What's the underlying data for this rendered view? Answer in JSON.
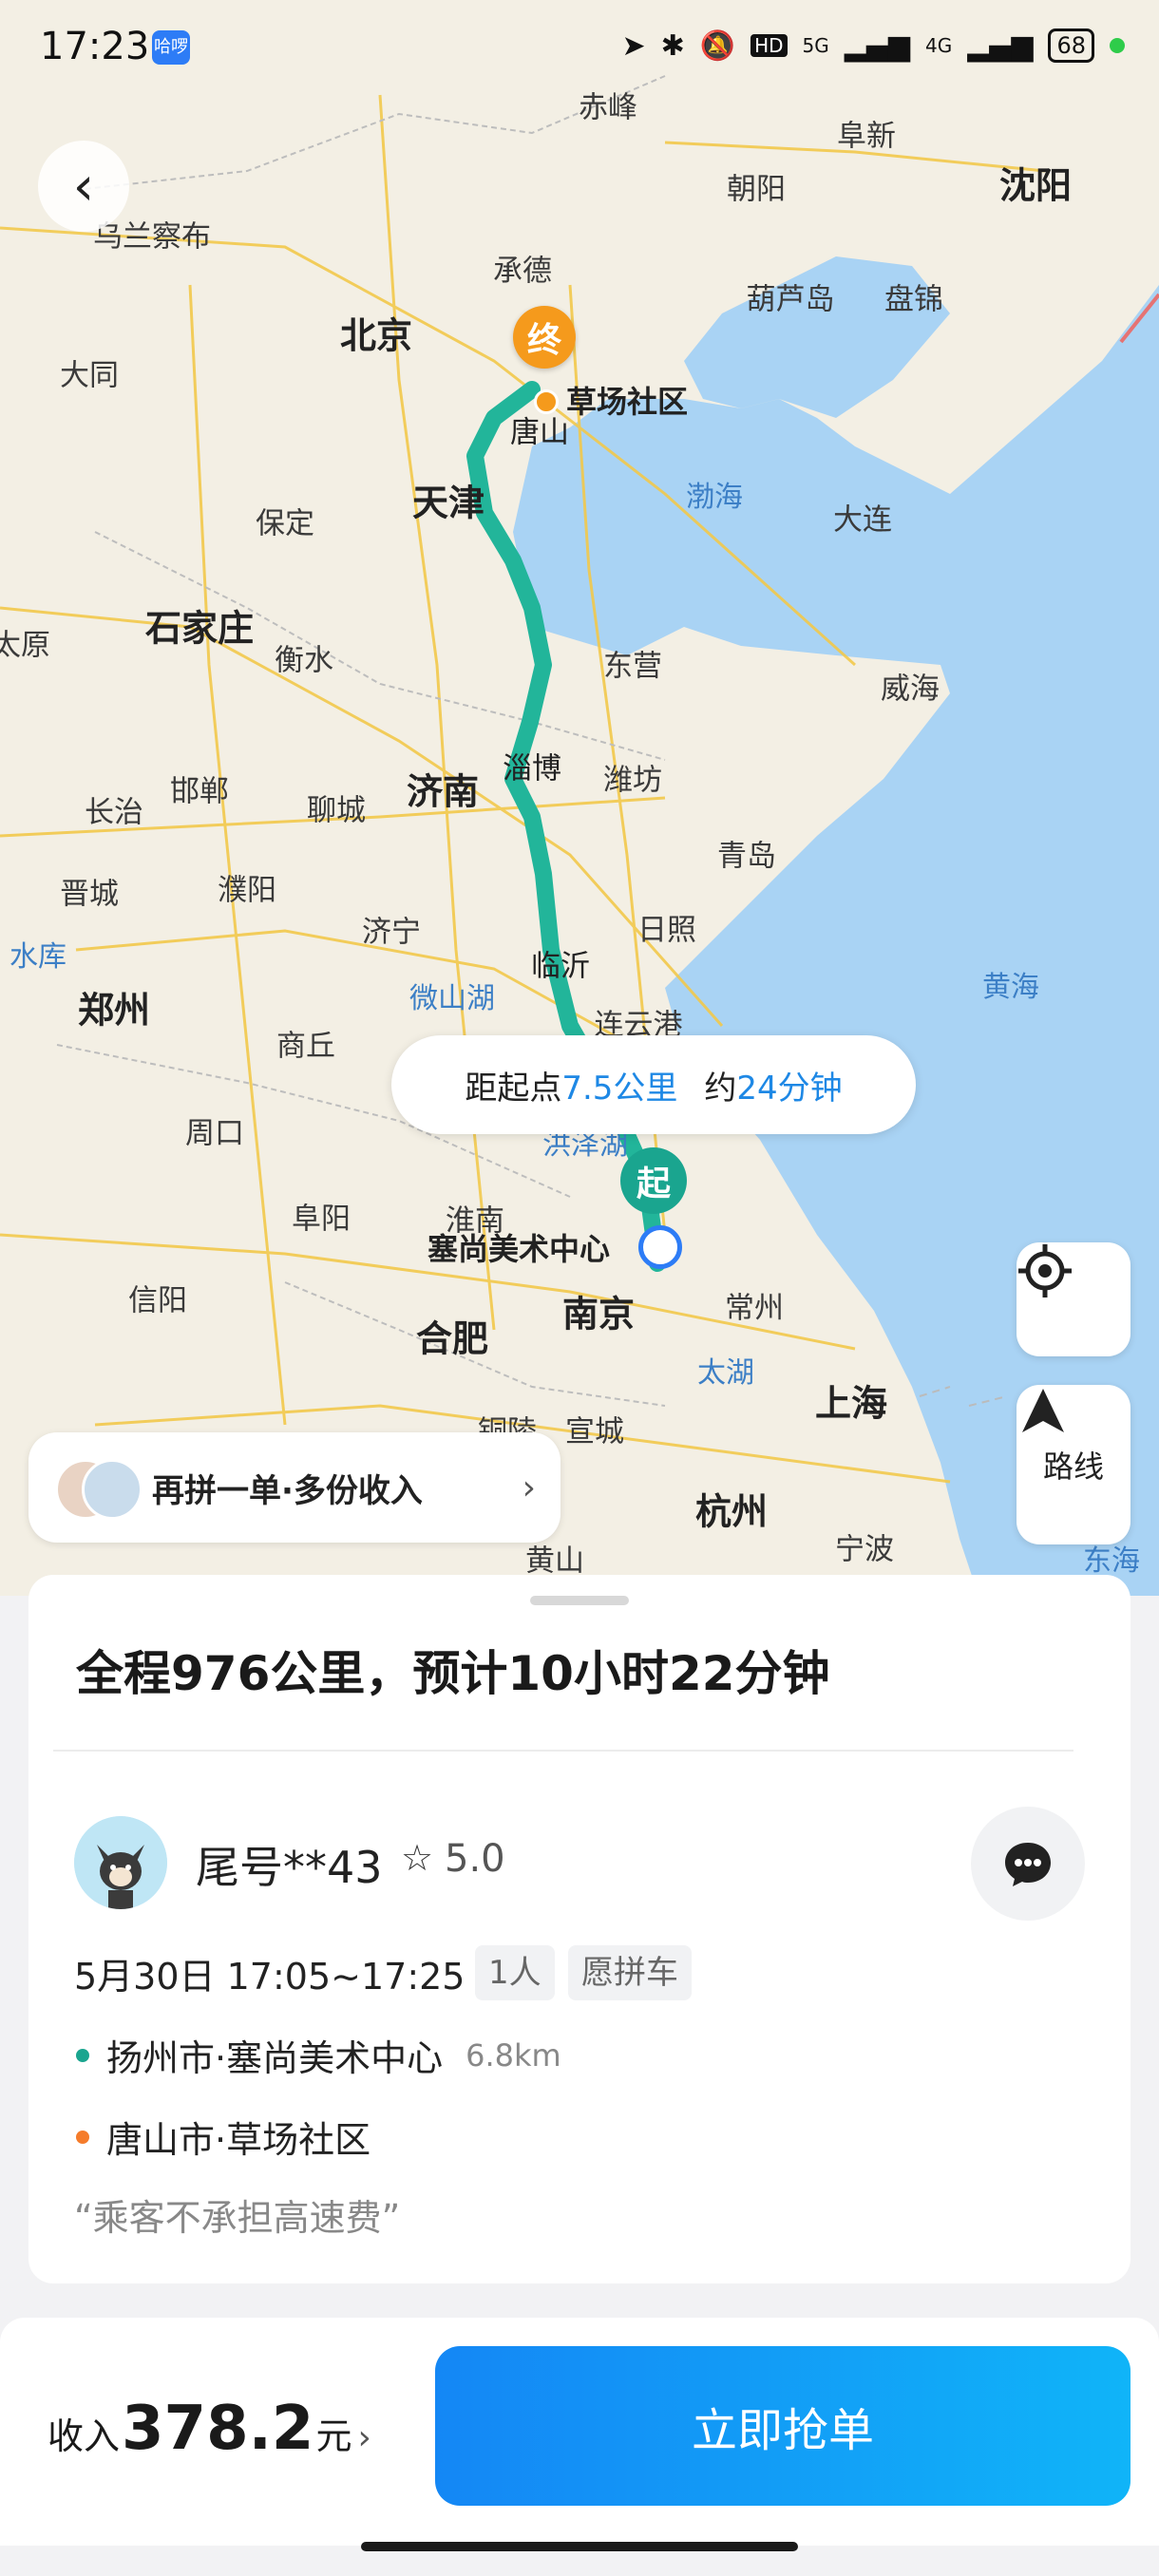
{
  "status_bar": {
    "time": "17:23",
    "app_badge": "哈啰",
    "signal_5g": "5G",
    "signal_4g": "4G",
    "hd": "HD",
    "battery": "68"
  },
  "map": {
    "cities": [
      "赤峰",
      "阜新",
      "沈阳",
      "乌兰察布",
      "承德",
      "朝阳",
      "葫芦岛",
      "盘锦",
      "北京",
      "大同",
      "唐山",
      "天津",
      "保定",
      "渤海",
      "大连",
      "石家庄",
      "衡水",
      "东营",
      "威海",
      "济南",
      "淄博",
      "潍坊",
      "邯郸",
      "聊城",
      "长治",
      "青岛",
      "晋城",
      "濮阳",
      "济宁",
      "日照",
      "临沂",
      "郑州",
      "微山湖",
      "连云港",
      "黄海",
      "商丘",
      "周口",
      "洪泽湖",
      "阜阳",
      "淮南",
      "信阳",
      "合肥",
      "南京",
      "常州",
      "太湖",
      "上海",
      "铜陵",
      "宣城",
      "杭州",
      "黄山",
      "宁波",
      "东海",
      "太原",
      "水库"
    ],
    "end_marker": "终",
    "end_label": "草场社区",
    "start_marker": "起",
    "start_label": "塞尚美术中心"
  },
  "distance_bubble": {
    "prefix": "距起点",
    "distance": "7.5公里",
    "middle": "约",
    "duration": "24分钟"
  },
  "route_button_label": "路线",
  "promo": {
    "text": "再拼一单·多份收入"
  },
  "order": {
    "summary": "全程976公里，预计10小时22分钟",
    "passenger_name": "尾号**43",
    "rating": "5.0",
    "time": "5月30日 17:05~17:25",
    "seats_tag": "1人",
    "carpool_tag": "愿拼车",
    "origin": "扬州市·塞尚美术中心",
    "origin_distance": "6.8km",
    "destination": "唐山市·草场社区",
    "note": "“乘客不承担高速费”"
  },
  "bottom": {
    "income_label": "收入",
    "income_amount": "378.2",
    "income_unit": "元",
    "action_label": "立即抢单"
  },
  "colors": {
    "route": "#22b59a",
    "origin_dot": "#1aa58f",
    "dest_dot": "#f57c2b",
    "accent": "#1e88e5",
    "sea": "#a9d3f4"
  }
}
